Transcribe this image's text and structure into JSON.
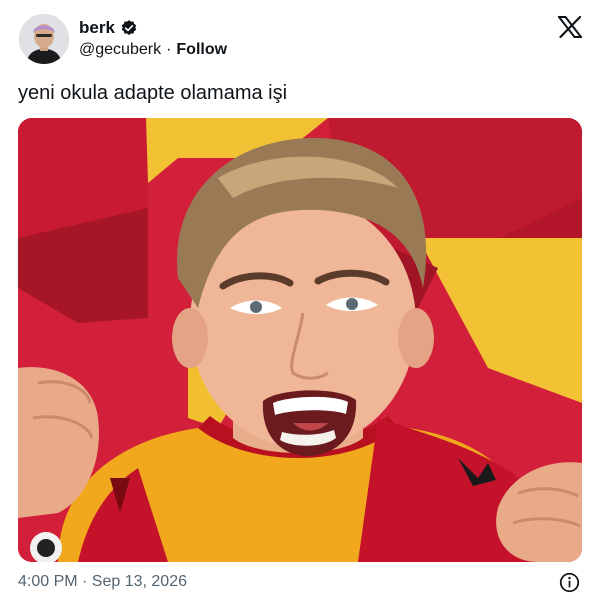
{
  "author": {
    "display_name": "berk",
    "handle": "@gecuberk",
    "separator": "·",
    "follow_label": "Follow"
  },
  "tweet": {
    "text": "yeni okula adapte olamama işi",
    "timestamp": "4:00 PM · Sep 13, 2026"
  },
  "icons": {
    "verified": "verified-badge-icon",
    "platform": "x-logo-icon",
    "info": "info-icon"
  },
  "colors": {
    "text_primary": "#0f1419",
    "text_secondary": "#536471",
    "jersey_red": "#c3122a",
    "jersey_yellow": "#f2a81d",
    "background_red": "#d3203a",
    "background_yellow": "#f3c234"
  }
}
